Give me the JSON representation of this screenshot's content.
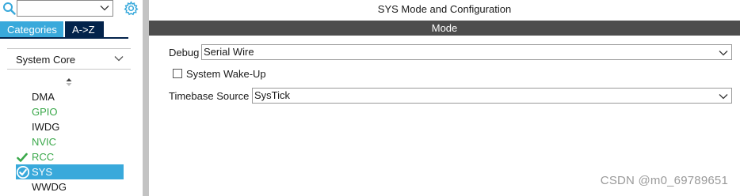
{
  "left_panel": {
    "tabs": [
      {
        "label": "Categories"
      },
      {
        "label": "A->Z"
      }
    ],
    "section": {
      "label": "System Core"
    },
    "items": [
      {
        "label": "DMA",
        "state": "plain"
      },
      {
        "label": "GPIO",
        "state": "green"
      },
      {
        "label": "IWDG",
        "state": "plain"
      },
      {
        "label": "NVIC",
        "state": "green"
      },
      {
        "label": "RCC",
        "state": "configured"
      },
      {
        "label": "SYS",
        "state": "selected"
      },
      {
        "label": "WWDG",
        "state": "plain"
      }
    ]
  },
  "main": {
    "title": "SYS Mode and Configuration",
    "mode_header": "Mode",
    "debug": {
      "label": "Debug",
      "value": "Serial Wire"
    },
    "wakeup": {
      "label": "System Wake-Up",
      "checked": false
    },
    "timebase": {
      "label": "Timebase Source",
      "value": "SysTick"
    }
  },
  "watermark": "CSDN @m0_69789651",
  "colors": {
    "accent": "#39a9db",
    "tab_dark": "#03234b",
    "green": "#3aa84a",
    "mode_bar": "#4d4d4d"
  },
  "icons": [
    "search-icon",
    "chevron-down-icon",
    "gear-icon",
    "sort-icon",
    "check-icon",
    "circle-check-icon"
  ]
}
